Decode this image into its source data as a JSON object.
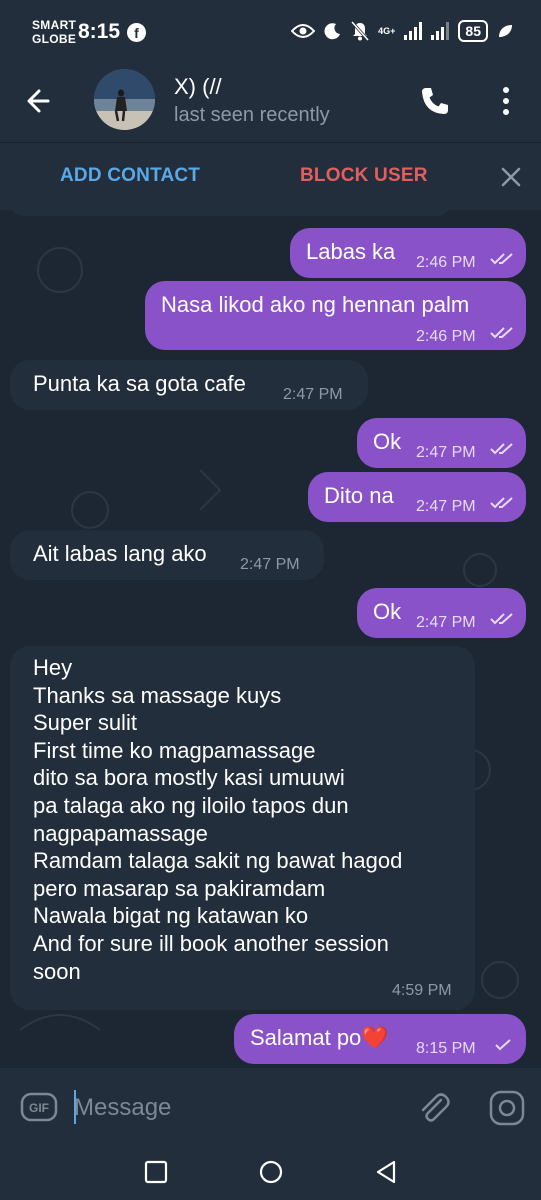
{
  "status_bar": {
    "carrier_line1": "SMART",
    "carrier_line2": "GLOBE",
    "time": "8:15",
    "network": "4G+",
    "battery": "85"
  },
  "header": {
    "name": "X) (//",
    "status": "last seen recently"
  },
  "actions": {
    "add_contact": "ADD CONTACT",
    "block_user": "BLOCK USER"
  },
  "messages": [
    {
      "dir": "out",
      "text": "Labas ka",
      "time": "2:46 PM",
      "status": "read"
    },
    {
      "dir": "out",
      "text": "Nasa likod ako ng hennan palm",
      "time": "2:46 PM",
      "status": "read"
    },
    {
      "dir": "in",
      "text": "Punta ka sa gota cafe",
      "time": "2:47 PM"
    },
    {
      "dir": "out",
      "text": "Ok",
      "time": "2:47 PM",
      "status": "read"
    },
    {
      "dir": "out",
      "text": "Dito na",
      "time": "2:47 PM",
      "status": "read"
    },
    {
      "dir": "in",
      "text": "Ait labas lang ako",
      "time": "2:47 PM"
    },
    {
      "dir": "out",
      "text": "Ok",
      "time": "2:47 PM",
      "status": "read"
    },
    {
      "dir": "in",
      "text": "Hey\nThanks sa massage kuys\nSuper sulit\nFirst time ko magpamassage\ndito sa bora mostly kasi umuuwi\npa talaga ako ng iloilo tapos dun\nnagpapamassage\nRamdam talaga sakit ng bawat hagod\npero masarap sa pakiramdam\nNawala bigat ng katawan ko\nAnd for sure ill book another session\nsoon",
      "time": "4:59 PM"
    },
    {
      "dir": "out",
      "text": "Salamat po❤️",
      "time": "8:15 PM",
      "status": "sent"
    }
  ],
  "input": {
    "placeholder": "Message"
  },
  "colors": {
    "outgoing_bubble": "#8a52c9",
    "incoming_bubble": "#232e3c",
    "background": "#1d2733",
    "accent": "#5aa8e6",
    "danger": "#e45e5e"
  },
  "icons": {
    "back": "arrow-left-icon",
    "call": "phone-icon",
    "more": "more-vertical-icon",
    "close": "close-icon",
    "gif": "gif-icon",
    "attach": "paperclip-icon",
    "camera": "camera-icon",
    "recents": "square-icon",
    "home": "circle-icon",
    "back_nav": "triangle-back-icon"
  }
}
